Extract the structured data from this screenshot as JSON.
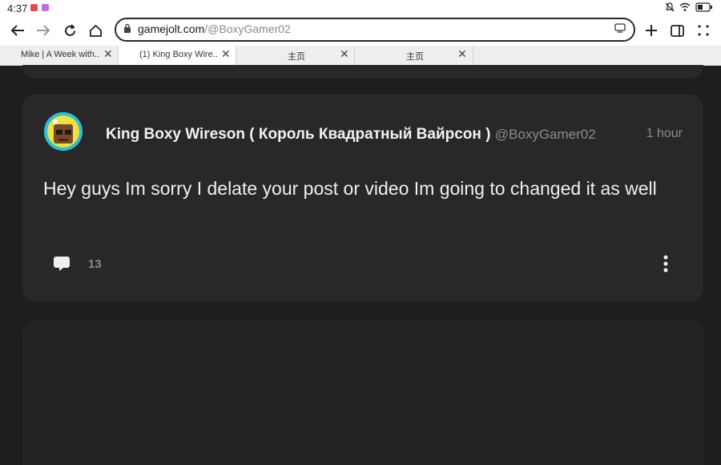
{
  "status_bar": {
    "time": "4:37"
  },
  "toolbar": {
    "url_domain": "gamejolt.com",
    "url_path": "/@BoxyGamer02"
  },
  "tabs": [
    {
      "label": "Mike | A Week with..."
    },
    {
      "label": "(1) King Boxy Wire..."
    },
    {
      "label": "主页"
    },
    {
      "label": "主页"
    }
  ],
  "post": {
    "author": "King Boxy Wireson ( Король Квадратный Вайрсон )",
    "handle": "@BoxyGamer02",
    "time": "1 hour",
    "content": "Hey guys Im sorry I delate your post or video Im going to changed it as well",
    "comment_count": "13"
  },
  "colors": {
    "page_bg": "#1f1d1d",
    "card_bg": "#292727",
    "avatar_bg": "#f4e24a"
  }
}
